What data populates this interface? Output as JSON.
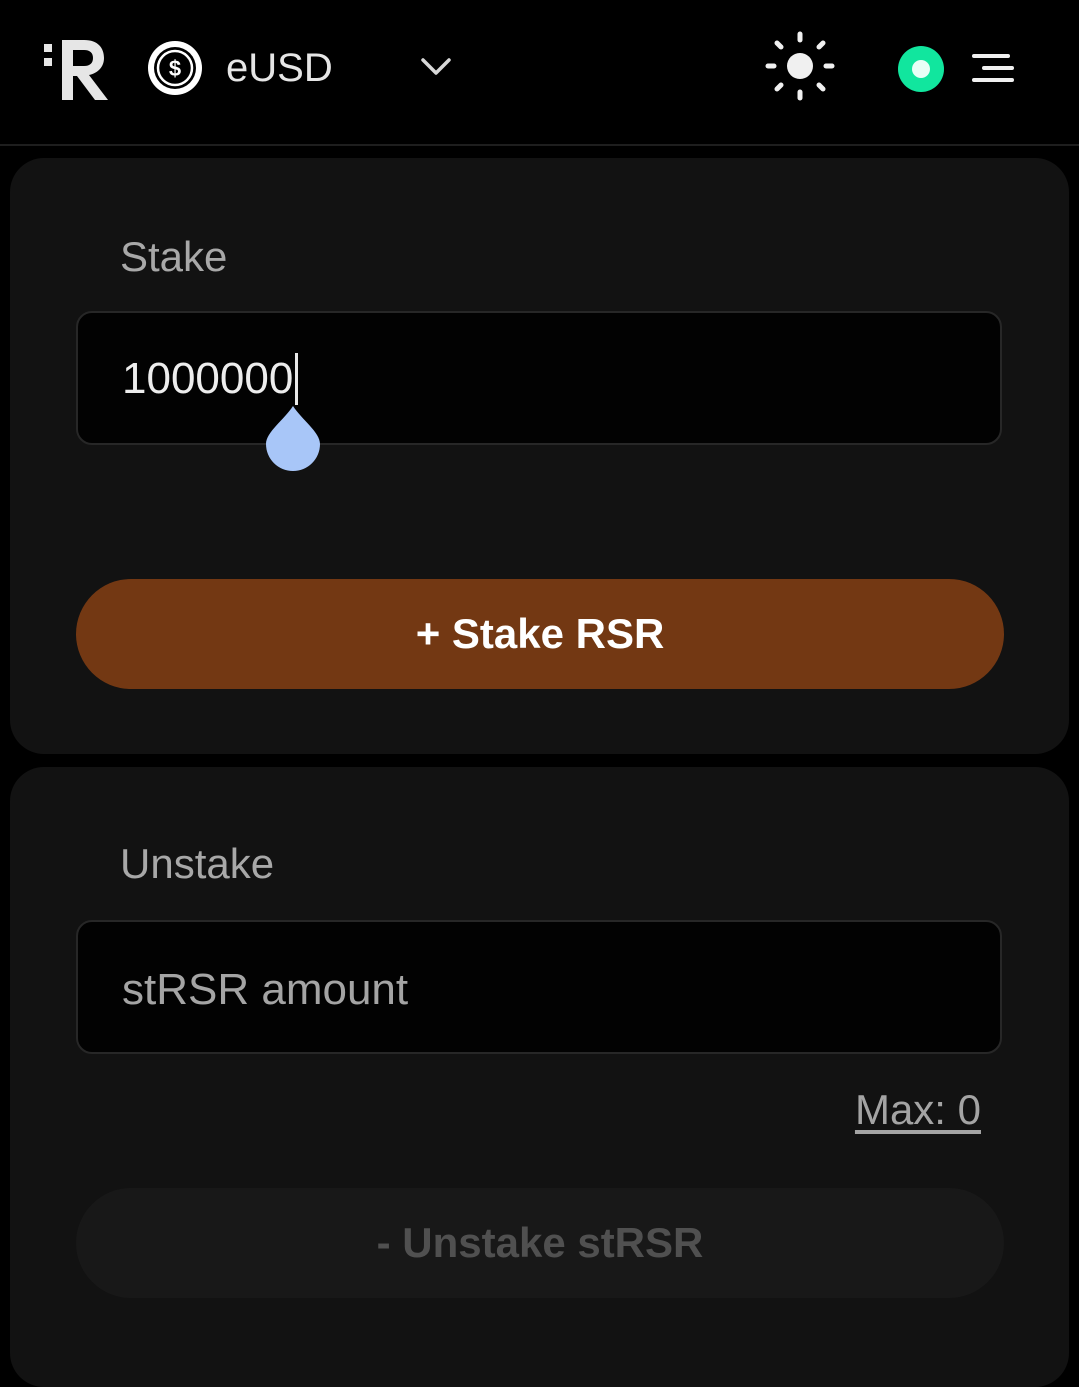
{
  "header": {
    "logo_icon": "reserve-logo-icon",
    "token_icon": "dollar-coin-icon",
    "token_name": "eUSD",
    "dropdown_icon": "chevron-down-icon",
    "theme_icon": "sun-icon",
    "status_icon": "connection-status-icon",
    "status_color": "#11e69e",
    "menu_icon": "menu-icon"
  },
  "stake": {
    "title": "Stake",
    "input_value": "1000000",
    "button_label": "+ Stake RSR",
    "button_color": "#733813"
  },
  "unstake": {
    "title": "Unstake",
    "input_placeholder": "stRSR amount",
    "max_label": "Max: 0",
    "button_label": "- Unstake stRSR"
  }
}
